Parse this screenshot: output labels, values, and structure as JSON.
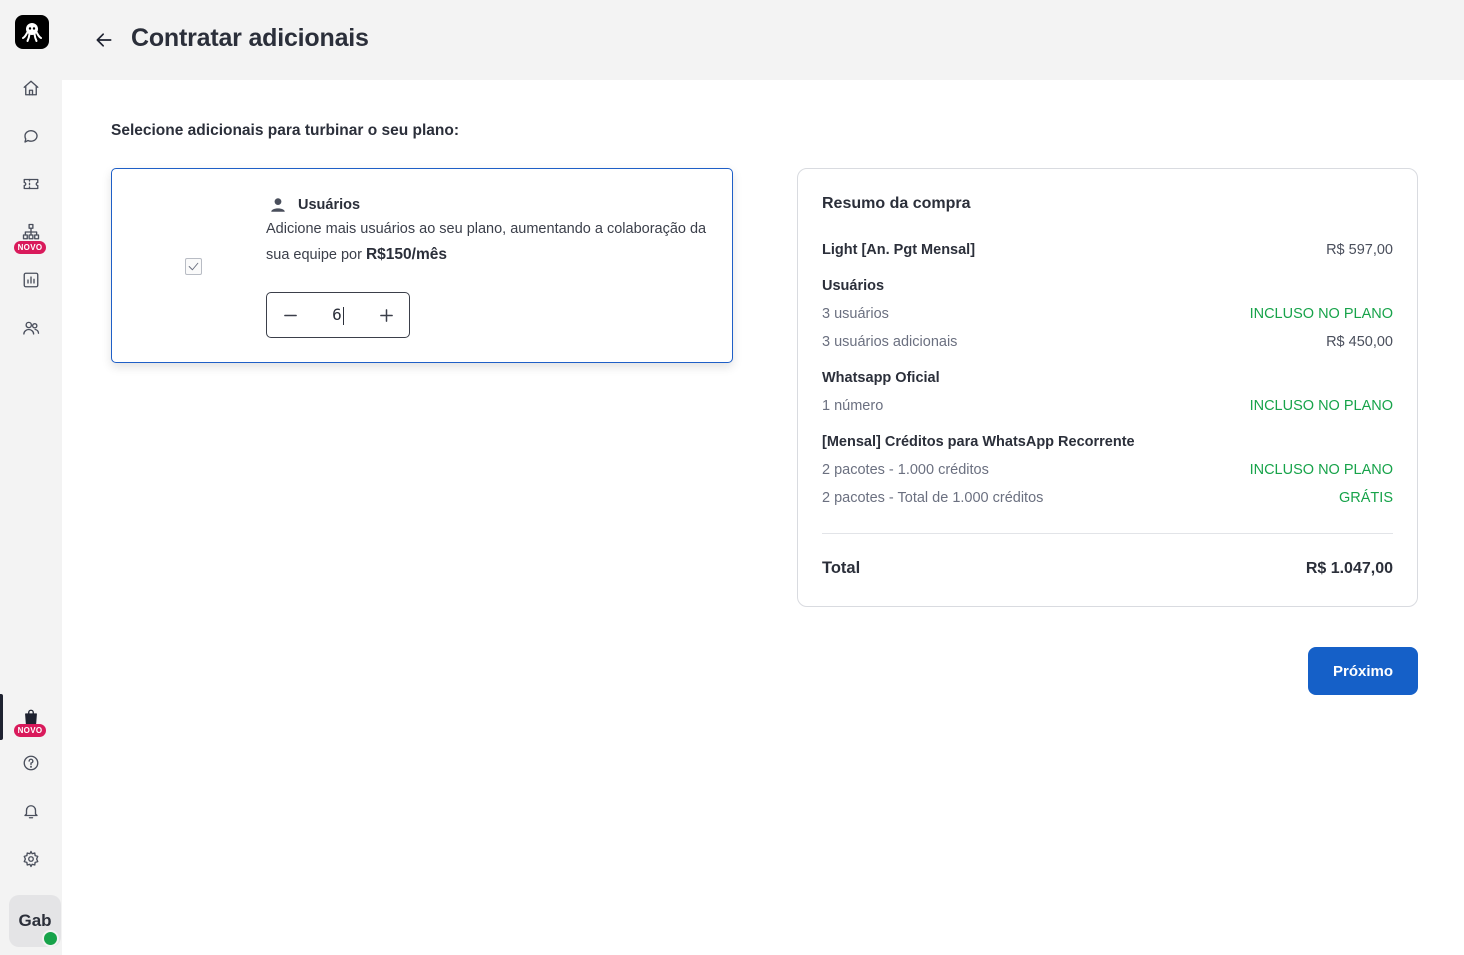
{
  "header": {
    "title": "Contratar adicionais"
  },
  "sidebar": {
    "items": [
      {
        "name": "home-icon"
      },
      {
        "name": "chat-icon"
      },
      {
        "name": "ticket-icon"
      },
      {
        "name": "sitemap-icon",
        "badge": "NOVO"
      },
      {
        "name": "reports-icon"
      },
      {
        "name": "contacts-icon"
      },
      {
        "name": "shopping-bag-icon",
        "badge": "NOVO",
        "active": true
      },
      {
        "name": "help-icon"
      },
      {
        "name": "bell-icon"
      },
      {
        "name": "gear-icon"
      }
    ],
    "avatar_initials": "Gab",
    "status_color": "#17a34a"
  },
  "main": {
    "section_heading": "Selecione adicionais para turbinar o seu plano:",
    "addon": {
      "title": "Usuários",
      "description": "Adicione mais usuários ao seu plano, aumentando a colaboração da sua equipe por",
      "price": "R$150/mês",
      "checked": true,
      "quantity": "6"
    }
  },
  "summary": {
    "title": "Resumo da compra",
    "plan": {
      "label": "Light [An. Pgt Mensal]",
      "value": "R$ 597,00"
    },
    "groups": [
      {
        "title": "Usuários",
        "rows": [
          {
            "label": "3 usuários",
            "value": "INCLUSO NO PLANO"
          },
          {
            "label": "3 usuários adicionais",
            "value": "R$ 450,00"
          }
        ]
      },
      {
        "title": "Whatsapp Oficial",
        "rows": [
          {
            "label": "1 número",
            "value": "INCLUSO NO PLANO"
          }
        ]
      },
      {
        "title": "[Mensal] Créditos para WhatsApp Recorrente",
        "rows": [
          {
            "label": "2 pacotes - 1.000 créditos",
            "value": "INCLUSO NO PLANO"
          },
          {
            "label": "2 pacotes - Total de 1.000 créditos",
            "value": "GRÁTIS"
          }
        ]
      }
    ],
    "total_label": "Total",
    "total_value": "R$ 1.047,00"
  },
  "actions": {
    "next_label": "Próximo"
  },
  "colors": {
    "accent": "#1560c8",
    "included_green": "#17a34a",
    "badge_pink": "#d91a5b"
  }
}
